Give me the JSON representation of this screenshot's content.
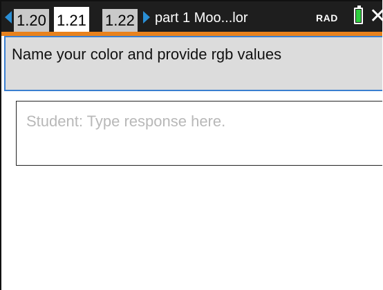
{
  "header": {
    "tabs": [
      {
        "label": "1.20",
        "active": false
      },
      {
        "label": "1.21",
        "active": true
      },
      {
        "label": "1.22",
        "active": false
      }
    ],
    "document_title": "part 1 Moo...lor",
    "angle_mode": "RAD",
    "battery_level": 1.0,
    "close_symbol": "✕",
    "colors": {
      "bar": "#1e1e1e",
      "accent": "#e8821e",
      "arrows": "#2a8fd6",
      "battery": "#2fcf3f"
    }
  },
  "question": {
    "text": "Name your color and provide rgb values"
  },
  "response": {
    "placeholder": "Student: Type response here.",
    "value": ""
  }
}
